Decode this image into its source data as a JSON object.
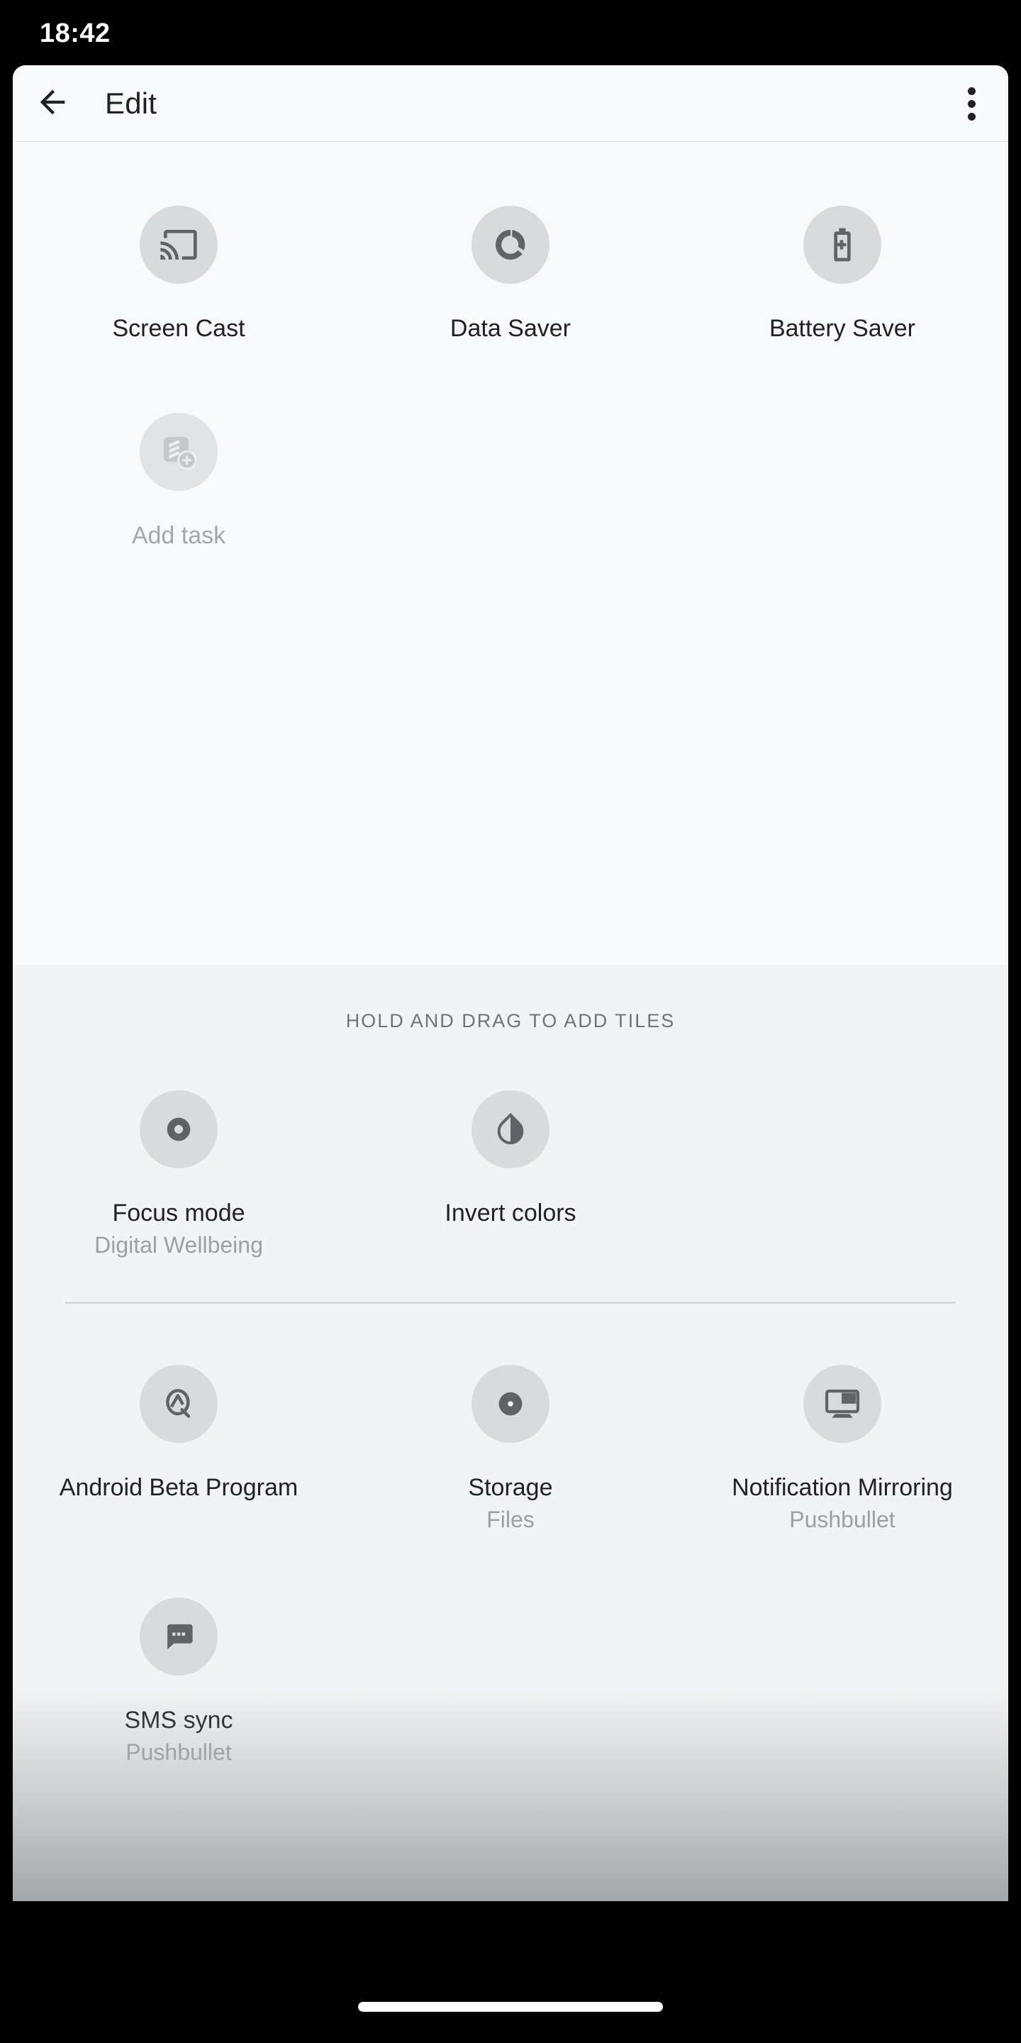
{
  "status_bar": {
    "clock": "18:42"
  },
  "app_bar": {
    "title": "Edit",
    "back_icon": "arrow-back-icon",
    "overflow_icon": "more-vert-icon"
  },
  "current_tiles": {
    "items": [
      {
        "label": "Screen Cast",
        "sub": "",
        "icon": "cast-icon",
        "state": "active"
      },
      {
        "label": "Data Saver",
        "sub": "",
        "icon": "data-saver-icon",
        "state": "active"
      },
      {
        "label": "Battery Saver",
        "sub": "",
        "icon": "battery-plus-icon",
        "state": "active"
      },
      {
        "label": "Add task",
        "sub": "",
        "icon": "add-task-icon",
        "state": "faded"
      }
    ]
  },
  "available_tiles": {
    "header": "HOLD AND DRAG TO ADD TILES",
    "group_one": [
      {
        "label": "Focus mode",
        "sub": "Digital Wellbeing",
        "icon": "focus-mode-icon"
      },
      {
        "label": "Invert colors",
        "sub": "",
        "icon": "invert-colors-icon"
      }
    ],
    "group_two": [
      {
        "label": "Android Beta Program",
        "sub": "",
        "icon": "android-q-icon"
      },
      {
        "label": "Storage",
        "sub": "Files",
        "icon": "storage-disc-icon"
      },
      {
        "label": "Notification Mirroring",
        "sub": "Pushbullet",
        "icon": "monitor-mirroring-icon"
      },
      {
        "label": "SMS sync",
        "sub": "Pushbullet",
        "icon": "chat-bubble-icon"
      }
    ]
  },
  "nav_bar": {
    "home_indicator": "home-indicator"
  },
  "colors": {
    "card_background": "#f8f9fa",
    "section_background": "#f1f3f4",
    "icon_circle": "#d8dadc",
    "icon_glyph": "#5f6368",
    "label_text": "#202124",
    "sub_text": "#9aa0a6",
    "header_text": "#6e7479",
    "divider": "#d5d7d9",
    "system_bar": "#000000"
  }
}
